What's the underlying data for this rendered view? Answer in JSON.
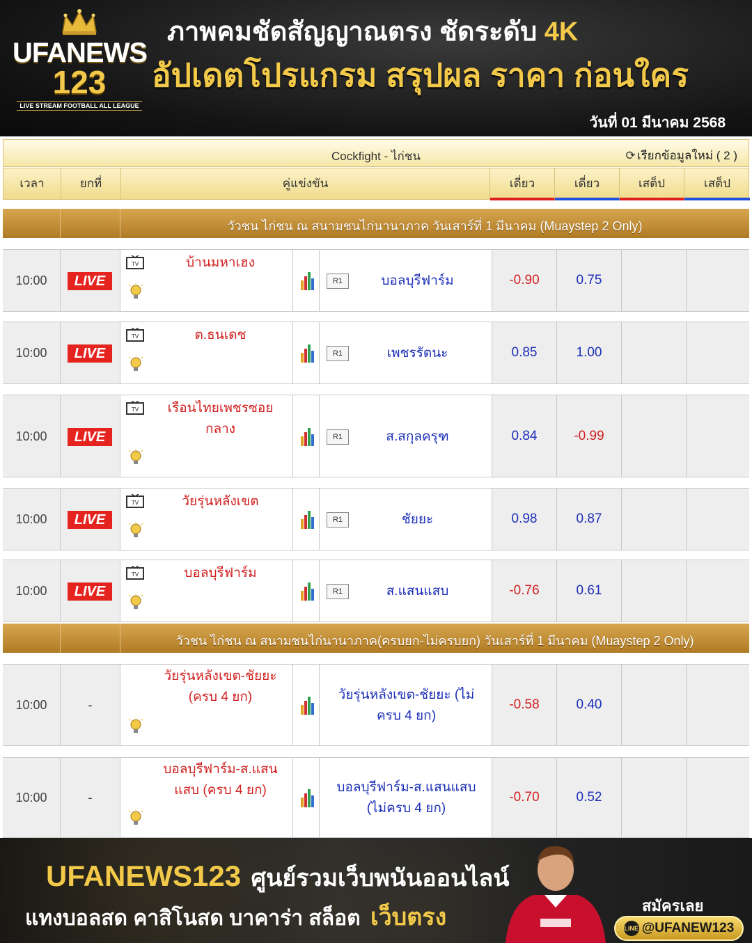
{
  "banner": {
    "logo_main": "UFANEWS",
    "logo_num": "123",
    "logo_tag": "LIVE STREAM FOOTBALL ALL LEAGUE",
    "headline1": "ภาพคมชัดสัญญาณตรง ชัดระดับ",
    "headline1_accent": "4K",
    "headline2": "อัปเดตโปรแกรม สรุปผล ราคา ก่อนใคร",
    "date": "วันที่ 01 มีนาคม 2568"
  },
  "table": {
    "title": "Cockfight - ไก่ชน",
    "refresh": "เรียกข้อมูลใหม่ ( 2 )",
    "headers": {
      "time": "เวลา",
      "round": "ยกที่",
      "match": "คู่แข่งขัน",
      "single1": "เดี่ยว",
      "single2": "เดี่ยว",
      "step1": "เสต็ป",
      "step2": "เสต็ป"
    },
    "leagues": [
      "วัวชน ไก่ชน ณ สนามชนไก่นานาภาค วันเสาร์ที่ 1 มีนาคม (Muaystep 2 Only)",
      "วัวชน ไก่ชน ณ สนามชนไก่นานาภาค(ครบยก-ไม่ครบยก) วันเสาร์ที่ 1 มีนาคม (Muaystep 2 Only)"
    ],
    "matches": [
      {
        "time": "10:00",
        "round": "LIVE",
        "home": "บ้านมหาเฮง",
        "tag": "R1",
        "away": "บอลบุรีฟาร์ม",
        "odd1": "-0.90",
        "odd2": "0.75"
      },
      {
        "time": "10:00",
        "round": "LIVE",
        "home": "ต.ธนเดช",
        "tag": "R1",
        "away": "เพชรรัตนะ",
        "odd1": "0.85",
        "odd2": "1.00"
      },
      {
        "time": "10:00",
        "round": "LIVE",
        "home": "เรือนไทยเพชรซอย กลาง",
        "tag": "R1",
        "away": "ส.สกุลครุฑ",
        "odd1": "0.84",
        "odd2": "-0.99"
      },
      {
        "time": "10:00",
        "round": "LIVE",
        "home": "วัยรุ่นหลังเขต",
        "tag": "R1",
        "away": "ชัยยะ",
        "odd1": "0.98",
        "odd2": "0.87"
      },
      {
        "time": "10:00",
        "round": "LIVE",
        "home": "บอลบุรีฟาร์ม",
        "tag": "R1",
        "away": "ส.แสนแสบ",
        "odd1": "-0.76",
        "odd2": "0.61"
      },
      {
        "time": "10:00",
        "round": "-",
        "home": "วัยรุ่นหลังเขต-ชัยยะ (ครบ 4 ยก)",
        "tag": "",
        "away": "วัยรุ่นหลังเขต-ชัยยะ (ไม่ครบ 4 ยก)",
        "odd1": "-0.58",
        "odd2": "0.40"
      },
      {
        "time": "10:00",
        "round": "-",
        "home": "บอลบุรีฟาร์ม-ส.แสนแสบ (ครบ 4 ยก)",
        "tag": "",
        "away": "บอลบุรีฟาร์ม-ส.แสนแสบ (ไม่ครบ 4 ยก)",
        "odd1": "-0.70",
        "odd2": "0.52"
      }
    ]
  },
  "footer": {
    "brand": "UFANEWS123",
    "tagline": "ศูนย์รวมเว็บพนันออนไลน์",
    "line2": "แทงบอลสด คาสิโนสด บาคาร่า สล็อต",
    "line2_accent": "เว็บตรง",
    "signup": "สมัครเลย",
    "line_id": "@UFANEW123",
    "line_icon_text": "LINE"
  },
  "colors": {
    "gold": "#f3c94a",
    "live_red": "#e52420",
    "neg_odd": "#d22020",
    "pos_odd": "#1c2fb8",
    "league_bar": "#c48e38"
  }
}
